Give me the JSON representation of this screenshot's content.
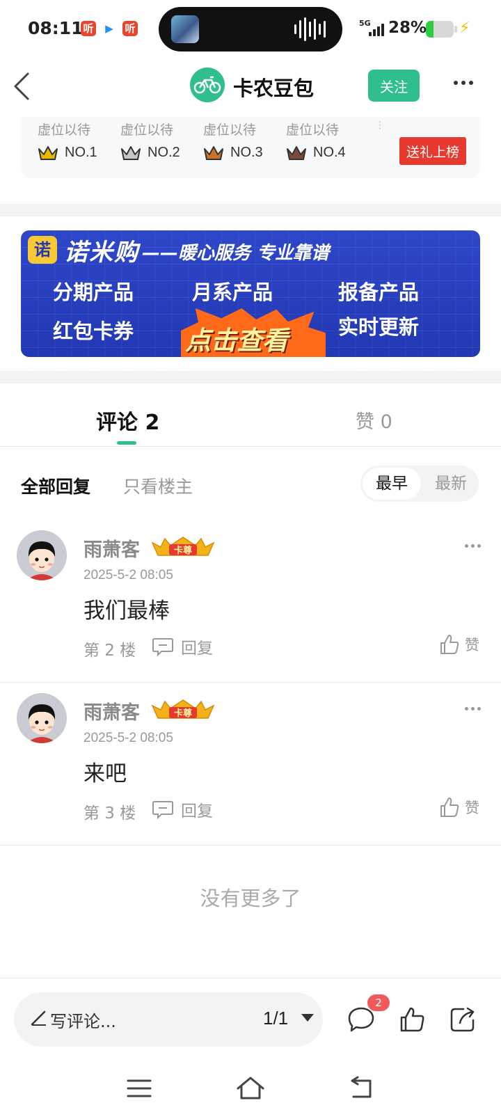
{
  "status_bar": {
    "time": "08:11",
    "app_icons": [
      "听",
      "▶",
      "听"
    ],
    "network": "5G",
    "battery_percent": "28%",
    "battery_level": 0.28,
    "charging_icon": "bolt-icon"
  },
  "header": {
    "title": "卡农豆包",
    "follow_label": "关注",
    "back_icon": "chevron-left-icon",
    "more_icon": "more-horizontal-icon"
  },
  "ranking": {
    "items": [
      {
        "label": "虚位以待",
        "rank": "NO.1",
        "crown_color": "#e6b800"
      },
      {
        "label": "虚位以待",
        "rank": "NO.2",
        "crown_color": "#9a9a9a"
      },
      {
        "label": "虚位以待",
        "rank": "NO.3",
        "crown_color": "#c9732b"
      },
      {
        "label": "虚位以待",
        "rank": "NO.4",
        "crown_color": "#7a4a3a"
      }
    ],
    "gift_button": "送礼上榜"
  },
  "banner": {
    "logo": "诺",
    "brand": "诺米购",
    "slogan": "——暖心服务 专业靠谱",
    "items": [
      "分期产品",
      "月系产品",
      "报备产品",
      "红包卡券",
      "实时更新"
    ],
    "cta": "点击查看"
  },
  "tabs": {
    "comments": "评论 2",
    "likes": "赞 0"
  },
  "filters": {
    "all": "全部回复",
    "op_only": "只看楼主",
    "sort_earliest": "最早",
    "sort_latest": "最新"
  },
  "comments": [
    {
      "name": "雨萧客",
      "badge": "卡尊",
      "time": "2025-5-2 08:05",
      "content": "我们最棒",
      "floor": "第 2 楼",
      "reply": "回复",
      "like": "赞"
    },
    {
      "name": "雨萧客",
      "badge": "卡尊",
      "time": "2025-5-2 08:05",
      "content": "来吧",
      "floor": "第 3 楼",
      "reply": "回复",
      "like": "赞"
    }
  ],
  "no_more": "没有更多了",
  "bottom_bar": {
    "placeholder": "写评论...",
    "page_indicator": "1/1",
    "comment_count_badge": "2"
  },
  "colors": {
    "accent": "#2fbf8e",
    "gift": "#e8392f",
    "banner_blue": "#2238b3",
    "badge_red": "#f05a5a"
  }
}
